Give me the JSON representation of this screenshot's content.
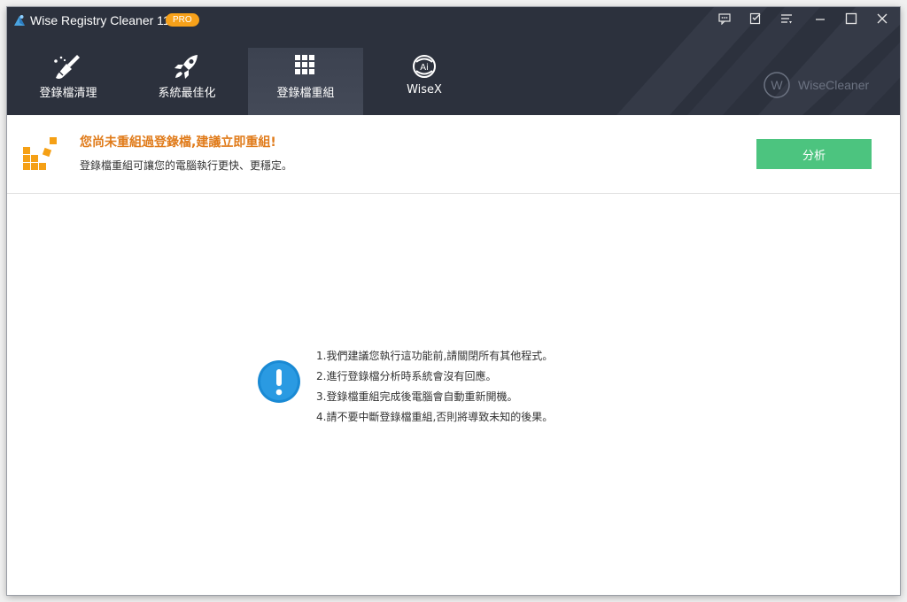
{
  "app": {
    "title": "Wise Registry Cleaner 11",
    "badge": "PRO",
    "brand": "WiseCleaner",
    "colors": {
      "header_bg": "#2c313d",
      "badge": "#f7a11a",
      "accent_green": "#4cc47f",
      "warning_orange": "#e07b1a",
      "info_blue": "#1a8ad4"
    }
  },
  "titlebar": {
    "buttons": [
      {
        "icon": "feedback-icon"
      },
      {
        "icon": "notes-icon"
      },
      {
        "icon": "menu-icon"
      },
      {
        "icon": "minimize-icon"
      },
      {
        "icon": "maximize-icon"
      },
      {
        "icon": "close-icon"
      }
    ]
  },
  "tabs": [
    {
      "label": "登錄檔清理",
      "icon": "broom-icon",
      "active": false
    },
    {
      "label": "系統最佳化",
      "icon": "rocket-icon",
      "active": false
    },
    {
      "label": "登錄檔重組",
      "icon": "grid-blocks-icon",
      "active": true
    },
    {
      "label": "WiseX",
      "icon": "wisex-ai-icon",
      "active": false
    }
  ],
  "notice": {
    "icon": "defrag-blocks-icon",
    "title": "您尚未重組過登錄檔,建議立即重組!",
    "description": "登錄檔重組可讓您的電腦執行更快、更穩定。",
    "button_label": "分析"
  },
  "info": {
    "icon": "info-exclamation-icon",
    "tips": [
      "1.我們建議您執行這功能前,請關閉所有其他程式。",
      "2.進行登錄檔分析時系統會沒有回應。",
      "3.登錄檔重組完成後電腦會自動重新開機。",
      "4.請不要中斷登錄檔重組,否則將導致未知的後果。"
    ]
  }
}
